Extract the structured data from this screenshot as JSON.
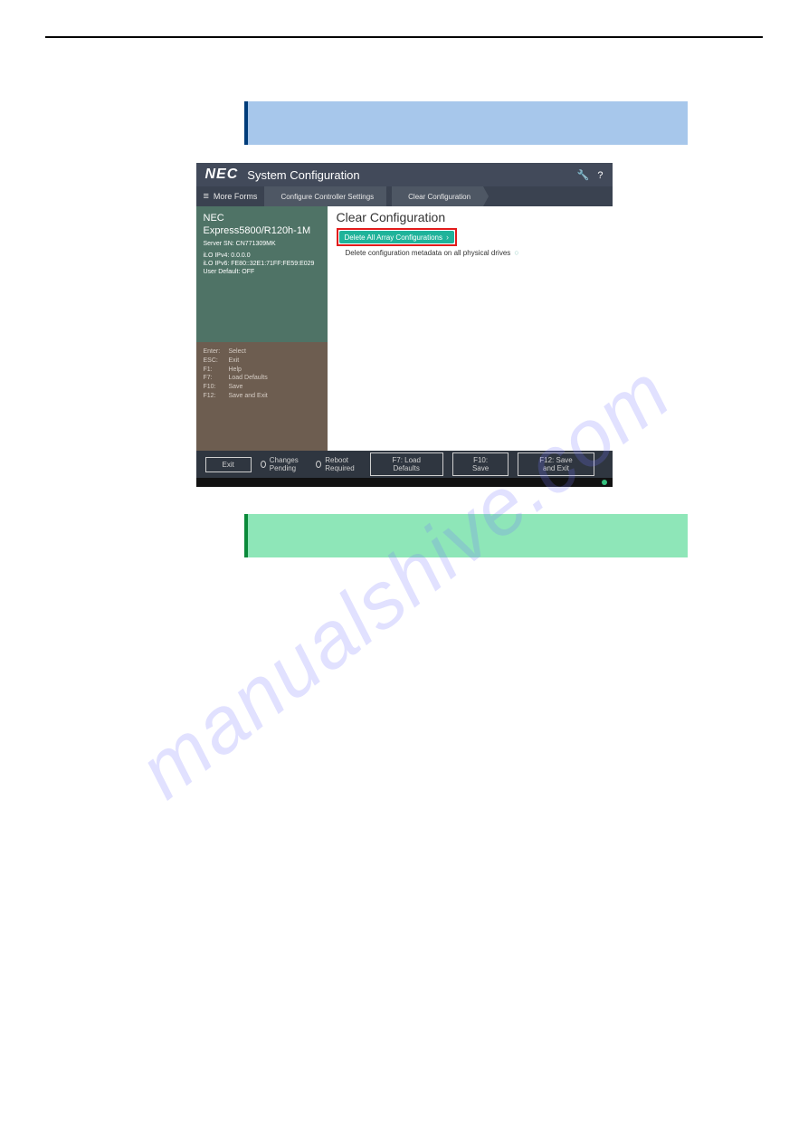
{
  "watermark": "manualshive.com",
  "screenshot": {
    "logo": "NEC",
    "title": "System Configuration",
    "topIcons": {
      "wrench": "🔧",
      "help": "?"
    },
    "menu_label": "More Forms",
    "menu_icon": "≡",
    "breadcrumb": [
      "Configure Controller Settings",
      "Clear Configuration"
    ],
    "sidebar": {
      "vendor": "NEC",
      "model": "Express5800/R120h-1M",
      "server_sn": "Server SN: CN771309MK",
      "ilo_ipv4": "iLO IPv4: 0.0.0.0",
      "ilo_ipv6": "iLO IPv6: FE80::32E1:71FF:FE59:E029",
      "user_default": "User Default: OFF",
      "keys": [
        {
          "k": "Enter:",
          "v": "Select"
        },
        {
          "k": "ESC:",
          "v": "Exit"
        },
        {
          "k": "F1:",
          "v": "Help"
        },
        {
          "k": "F7:",
          "v": "Load Defaults"
        },
        {
          "k": "F10:",
          "v": "Save"
        },
        {
          "k": "F12:",
          "v": "Save and Exit"
        }
      ]
    },
    "main": {
      "heading": "Clear Configuration",
      "option_primary": "Delete All Array Configurations",
      "option_secondary": "Delete configuration metadata on all physical drives"
    },
    "footer": {
      "exit": "Exit",
      "changes_pending": "Changes Pending",
      "reboot_required": "Reboot Required",
      "f7": "F7: Load Defaults",
      "f10": "F10: Save",
      "f12": "F12: Save and Exit"
    }
  }
}
